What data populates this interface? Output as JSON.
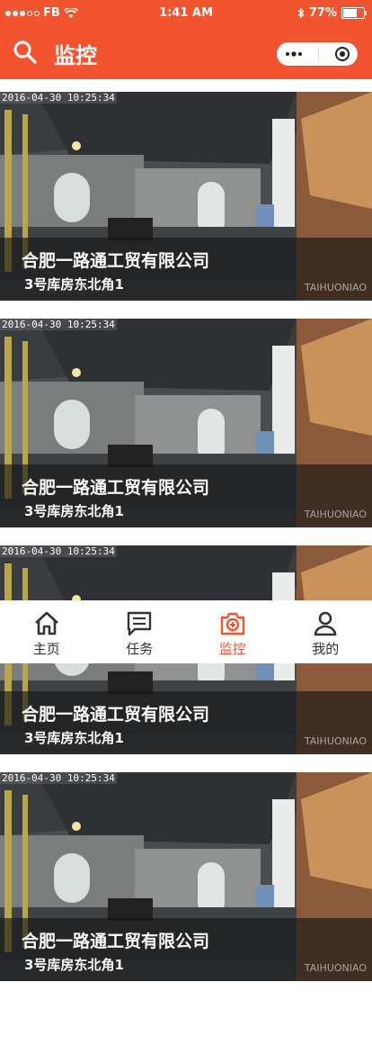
{
  "status_bar": {
    "carrier": "FB",
    "time": "1:41 AM",
    "battery": "77%",
    "battery_level": 0.77
  },
  "nav": {
    "title": "监控",
    "search_icon": "search-icon",
    "capsule_icons": [
      "more-icon",
      "close-target-icon"
    ]
  },
  "colors": {
    "accent": "#f2542f",
    "tab_inactive": "#333333"
  },
  "cameras": [
    {
      "timestamp": "2016-04-30 10:25:34",
      "company": "合肥一路通工贸有限公司",
      "location": "3号库房东北角1",
      "watermark": "TAIHUONIAO"
    },
    {
      "timestamp": "2016-04-30 10:25:34",
      "company": "合肥一路通工贸有限公司",
      "location": "3号库房东北角1",
      "watermark": "TAIHUONIAO"
    },
    {
      "timestamp": "2016-04-30 10:25:34",
      "company": "合肥一路通工贸有限公司",
      "location": "3号库房东北角1",
      "watermark": "TAIHUONIAO"
    },
    {
      "timestamp": "2016-04-30 10:25:34",
      "company": "合肥一路通工贸有限公司",
      "location": "3号库房东北角1",
      "watermark": "TAIHUONIAO"
    }
  ],
  "tabs": [
    {
      "label": "主页",
      "icon": "home-icon",
      "active": false
    },
    {
      "label": "任务",
      "icon": "message-list-icon",
      "active": false
    },
    {
      "label": "监控",
      "icon": "camera-icon",
      "active": true
    },
    {
      "label": "我的",
      "icon": "user-icon",
      "active": false
    }
  ]
}
